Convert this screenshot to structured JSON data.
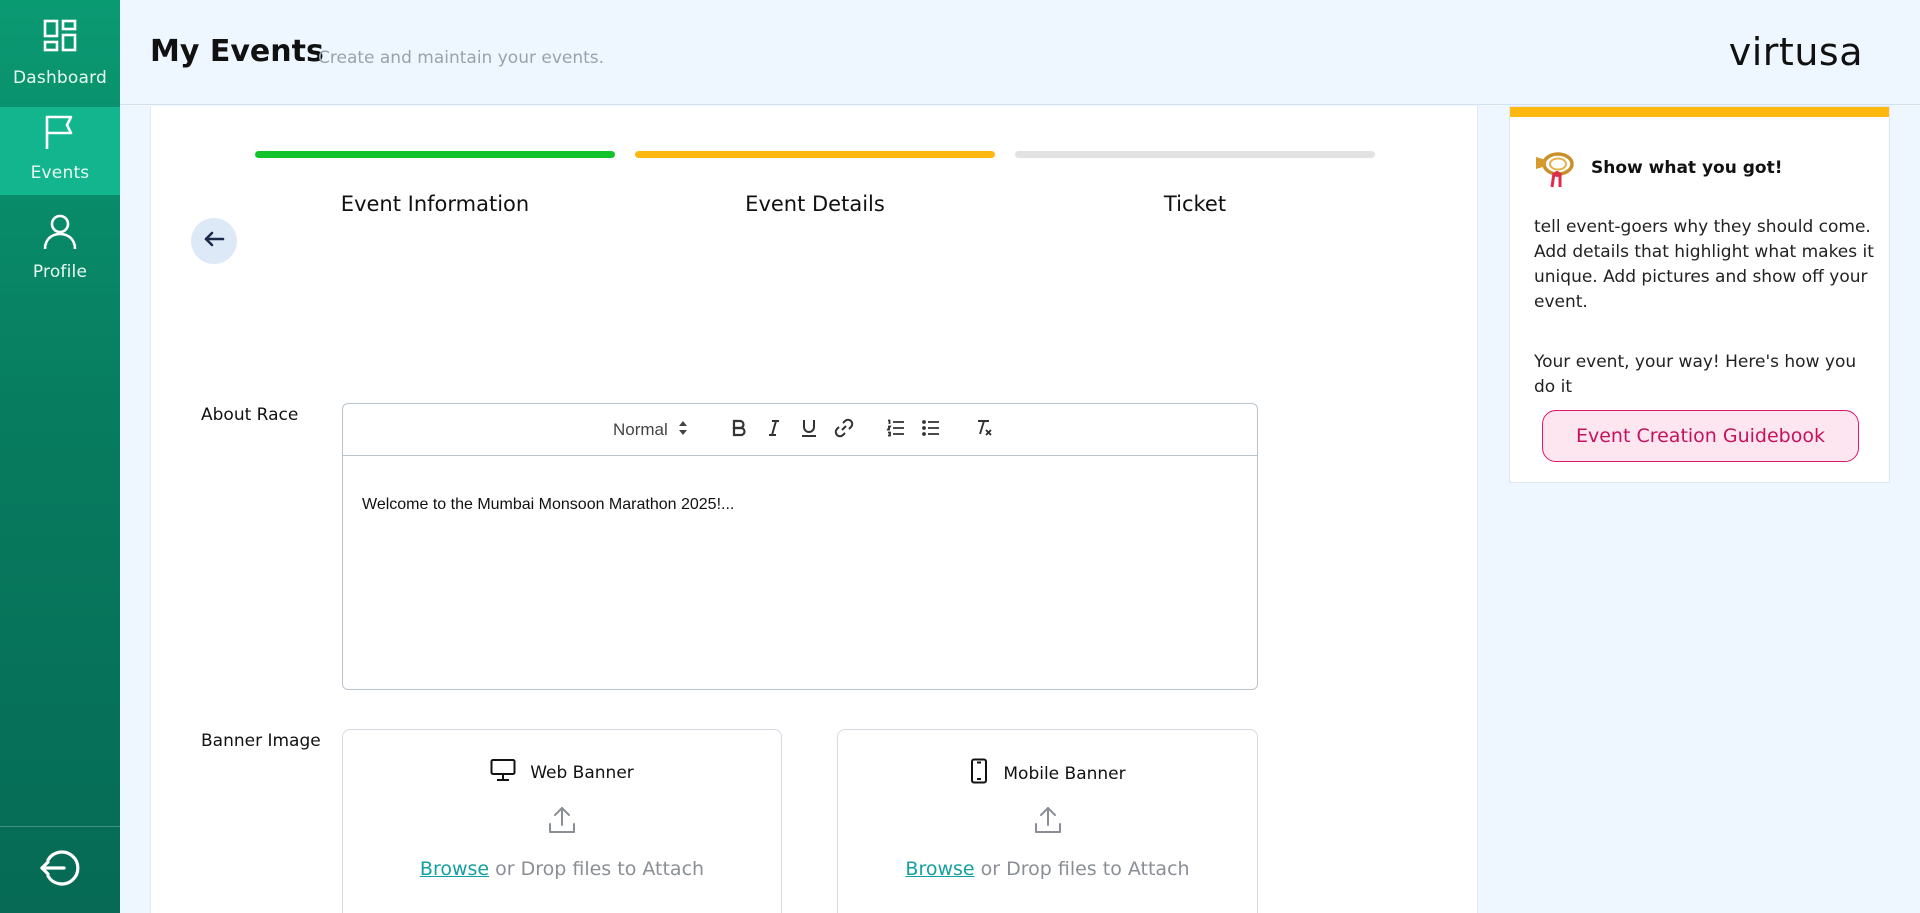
{
  "sidebar": {
    "items": [
      {
        "label": "Dashboard",
        "icon": "dashboard-icon",
        "active": false
      },
      {
        "label": "Events",
        "icon": "flag-icon",
        "active": true
      },
      {
        "label": "Profile",
        "icon": "user-icon",
        "active": false
      }
    ],
    "logout_icon": "logout-icon"
  },
  "header": {
    "title": "My Events",
    "subtitle": "Create and maintain your events.",
    "logo": "virtusa"
  },
  "steps": [
    {
      "label": "Event Information",
      "status": "complete",
      "color": "#12c42a"
    },
    {
      "label": "Event Details",
      "status": "current",
      "color": "#ffb810"
    },
    {
      "label": "Ticket",
      "status": "pending",
      "color": "#e2e2e2"
    }
  ],
  "form": {
    "about_label": "About Race",
    "editor": {
      "format_value": "Normal",
      "content": "Welcome to the Mumbai Monsoon Marathon 2025!..."
    },
    "banner_label": "Banner Image",
    "uploads": [
      {
        "title": "Web Banner",
        "icon": "monitor-icon",
        "browse": "Browse",
        "hint": " or Drop files to Attach"
      },
      {
        "title": "Mobile Banner",
        "icon": "mobile-icon",
        "browse": "Browse",
        "hint": " or Drop files to Attach"
      }
    ]
  },
  "tip": {
    "title": "Show what you got!",
    "paragraph1": "tell event-goers why they should come. Add details that highlight what makes it unique. Add pictures and show off your event.",
    "paragraph2": "Your event, your way! Here's how you do it",
    "button": "Event Creation Guidebook",
    "accent_color": "#ffb810"
  },
  "colors": {
    "sidebar": "#077c5f",
    "sidebar_active": "#13b58e",
    "link": "#14a0a0",
    "guide_button": "#c6125d"
  }
}
